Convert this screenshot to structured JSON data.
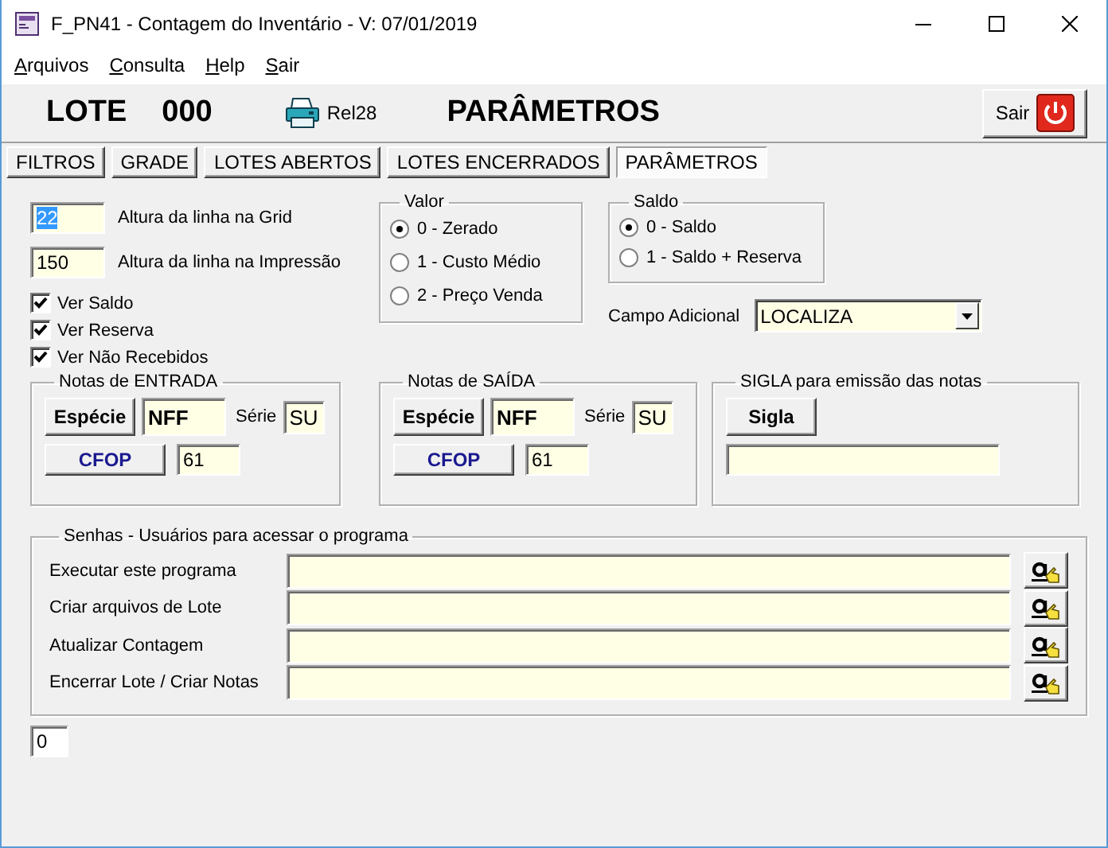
{
  "window": {
    "title": "F_PN41 - Contagem do Inventário - V: 07/01/2019"
  },
  "menu": [
    "Arquivos",
    "Consulta",
    "Help",
    "Sair"
  ],
  "header": {
    "lote_label": "LOTE",
    "lote_number": "000",
    "report": "Rel28",
    "title": "PARÂMETROS",
    "exit": "Sair"
  },
  "tabs": [
    {
      "label": "FILTROS",
      "selected": false
    },
    {
      "label": "GRADE",
      "selected": false
    },
    {
      "label": "LOTES ABERTOS",
      "selected": false
    },
    {
      "label": "LOTES ENCERRADOS",
      "selected": false
    },
    {
      "label": "PARÂMETROS",
      "selected": true
    }
  ],
  "line_heights": [
    {
      "value": "22",
      "label": "Altura da linha na Grid",
      "focused": true
    },
    {
      "value": "150",
      "label": "Altura da linha na Impressão",
      "focused": false
    }
  ],
  "checkboxes": [
    {
      "label": "Ver Saldo",
      "checked": true
    },
    {
      "label": "Ver Reserva",
      "checked": true
    },
    {
      "label": "Ver Não Recebidos",
      "checked": true
    }
  ],
  "valor": {
    "title": "Valor",
    "options": [
      {
        "label": "0 - Zerado",
        "selected": true
      },
      {
        "label": "1 - Custo Médio",
        "selected": false
      },
      {
        "label": "2 - Preço Venda",
        "selected": false
      }
    ]
  },
  "saldo": {
    "title": "Saldo",
    "options": [
      {
        "label": "0 - Saldo",
        "selected": true
      },
      {
        "label": "1 - Saldo + Reserva",
        "selected": false
      }
    ]
  },
  "campo_adicional": {
    "label": "Campo Adicional",
    "value": "LOCALIZA"
  },
  "notas": [
    {
      "title": "Notas de ENTRADA",
      "especie_button": "Espécie",
      "especie": "NFF",
      "serie_label": "Série",
      "serie": "SU",
      "cfop_button": "CFOP",
      "cfop": "61"
    },
    {
      "title": "Notas de SAÍDA",
      "especie_button": "Espécie",
      "especie": "NFF",
      "serie_label": "Série",
      "serie": "SU",
      "cfop_button": "CFOP",
      "cfop": "61"
    }
  ],
  "sigla": {
    "title": "SIGLA para emissão das notas",
    "button": "Sigla"
  },
  "senhas": {
    "title": "Senhas - Usuários para acessar o programa",
    "rows": [
      "Executar este programa",
      "Criar arquivos de Lote",
      "Atualizar Contagem",
      "Encerrar Lote / Criar Notas"
    ]
  },
  "counter": "0"
}
